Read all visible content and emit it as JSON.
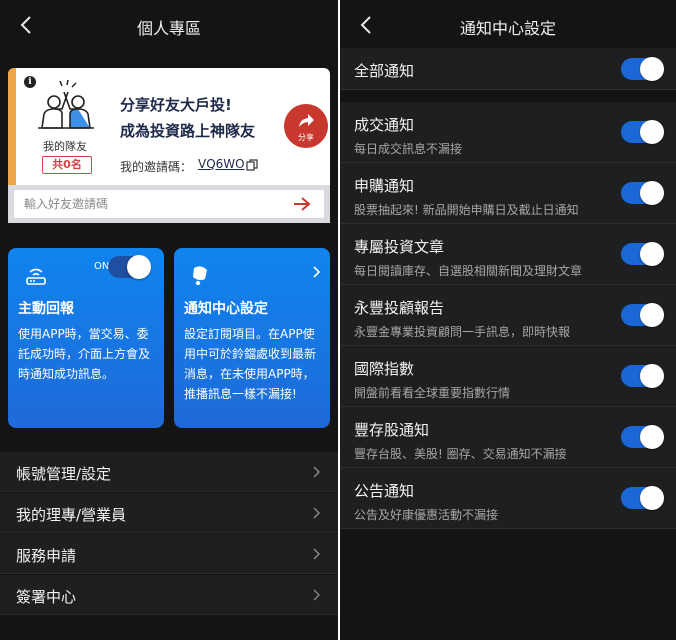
{
  "left": {
    "nav_title": "個人專區",
    "referral": {
      "my_team_label": "我的隊友",
      "team_count": "共0名",
      "headline_1": "分享好友大戶投!",
      "headline_2": "成為投資路上神隊友",
      "invite_label": "我的邀請碼：",
      "invite_code": "VQ6WO",
      "share_label": "分享",
      "input_placeholder": "輸入好友邀請碼"
    },
    "push_card": {
      "toggle_label": "ON",
      "toggle_on": true,
      "title": "主動回報",
      "desc": "使用APP時，當交易、委託成功時，介面上方會及時通知成功訊息。"
    },
    "notif_card": {
      "title": "通知中心設定",
      "desc": "設定訂閱項目。在APP使用中可於鈴鐺處收到最新消息，在未使用APP時，推播訊息一樣不漏接!"
    },
    "menu": [
      {
        "label": "帳號管理/設定"
      },
      {
        "label": "我的理專/營業員"
      },
      {
        "label": "服務申請"
      },
      {
        "label": "簽署中心"
      }
    ]
  },
  "right": {
    "nav_title": "通知中心設定",
    "all": {
      "title": "全部通知",
      "on": true
    },
    "settings": [
      {
        "title": "成交通知",
        "desc": "每日成交訊息不漏接",
        "on": true
      },
      {
        "title": "申購通知",
        "desc": "股票抽起來! 新品開始申購日及截止日通知",
        "on": true
      },
      {
        "title": "專屬投資文章",
        "desc": "每日閱讀庫存、自選股相關新聞及理財文章",
        "on": true
      },
      {
        "title": "永豐投顧報告",
        "desc": "永豐金專業投資顧問一手訊息，即時快報",
        "on": true
      },
      {
        "title": "國際指數",
        "desc": "開盤前看看全球重要指數行情",
        "on": true
      },
      {
        "title": "豐存股通知",
        "desc": "豐存台股、美股! 圈存、交易通知不漏接",
        "on": true
      },
      {
        "title": "公告通知",
        "desc": "公告及好康優惠活動不漏接",
        "on": true
      }
    ]
  },
  "colors": {
    "background": "#141414",
    "row": "#1d1f21",
    "toggle_on": "#1a68d6",
    "card_blue": "#0f84ee",
    "share_red": "#c9382e",
    "accent_orange": "#eda54a"
  }
}
